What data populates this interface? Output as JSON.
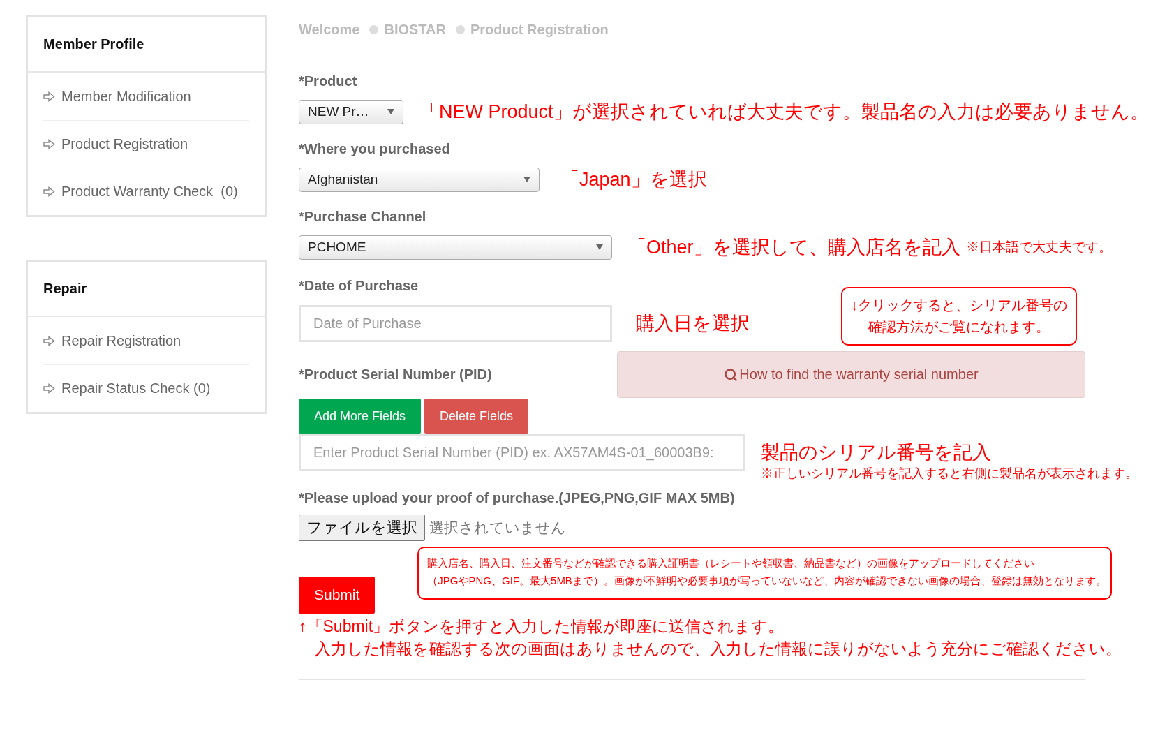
{
  "sidebar": [
    {
      "title": "Member Profile",
      "items": [
        {
          "label": "Member Modification"
        },
        {
          "label": "Product Registration"
        },
        {
          "label": "Product Warranty Check  (0)"
        }
      ]
    },
    {
      "title": "Repair",
      "items": [
        {
          "label": "Repair Registration"
        },
        {
          "label": "Repair Status Check (0)"
        }
      ]
    }
  ],
  "breadcrumb": [
    {
      "label": "Welcome"
    },
    {
      "label": "BIOSTAR"
    },
    {
      "label": "Product Registration"
    }
  ],
  "product": {
    "label": "*Product",
    "value": "NEW Pr…",
    "note": "「NEW Product」が選択されていれば大丈夫です。製品名の入力は必要ありません。"
  },
  "country": {
    "label": "*Where you purchased",
    "value": "Afghanistan",
    "note": "「Japan」を選択"
  },
  "channel": {
    "label": "*Purchase Channel",
    "value": "PCHOME",
    "note": "「Other」を選択して、購入店名を記入",
    "note_small": "※日本語で大丈夫です。"
  },
  "date": {
    "label": "*Date of Purchase",
    "placeholder": "Date of Purchase",
    "note": "購入日を選択",
    "callout": [
      "↓クリックすると、シリアル番号の",
      "確認方法がご覧になれます。"
    ]
  },
  "serial": {
    "label": "*Product Serial Number (PID)",
    "help_button": "How to find the warranty serial number",
    "add_button": "Add More Fields",
    "delete_button": "Delete Fields",
    "placeholder": "Enter Product Serial Number (PID) ex. AX57AM4S-01_60003B9:",
    "note": "製品のシリアル番号を記入",
    "note_small": "※正しいシリアル番号を記入すると右側に製品名が表示されます。"
  },
  "upload": {
    "label": "*Please upload your proof of purchase.(JPEG,PNG,GIF MAX 5MB)",
    "choose_button": "ファイルを選択",
    "status": "選択されていません",
    "callout": [
      "購入店名、購入日、注文番号などが確認できる購入証明書（レシートや領収書、納品書など）の画像をアップロードしてください",
      "（JPGやPNG、GIF。最大5MBまで）。画像が不鮮明や必要事項が写っていないなど、内容が確認できない画像の場合、登録は無効となります。"
    ]
  },
  "submit": {
    "label": "Submit"
  },
  "footer_note": [
    "↑「Submit」ボタンを押すと入力した情報が即座に送信されます。",
    "　入力した情報を確認する次の画面はありませんので、入力した情報に誤りがないよう充分にご確認ください。"
  ]
}
